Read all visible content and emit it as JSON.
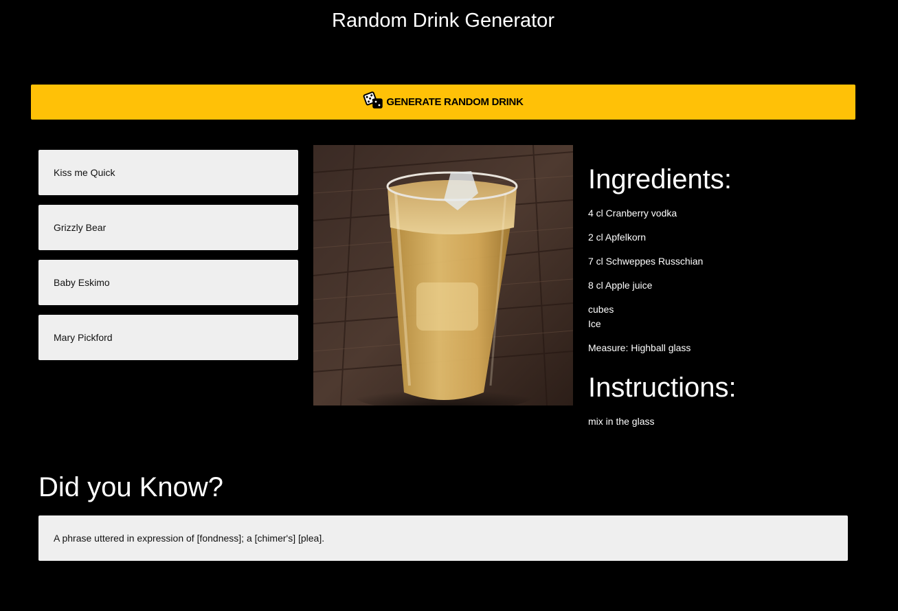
{
  "header": {
    "title": "Random Drink Generator"
  },
  "toolbar": {
    "generate_label": "GENERATE RANDOM DRINK",
    "generate_icon": "dice-icon"
  },
  "drinks": {
    "items": [
      {
        "label": "Kiss me Quick"
      },
      {
        "label": "Grizzly Bear"
      },
      {
        "label": "Baby Eskimo"
      },
      {
        "label": "Mary Pickford"
      }
    ]
  },
  "details": {
    "ingredients_heading": "Ingredients:",
    "ingredients": [
      "4 cl Cranberry vodka",
      "2 cl Apfelkorn",
      "7 cl Schweppes Russchian",
      "8 cl Apple juice"
    ],
    "ice_line_1": "cubes",
    "ice_line_2": "Ice",
    "measure": "Measure: Highball glass",
    "instructions_heading": "Instructions:",
    "instructions": "mix in the glass"
  },
  "fact": {
    "heading": "Did you Know?",
    "text": "A phrase uttered in expression of [fondness]; a [chimer's] [plea]."
  },
  "colors": {
    "background": "#000000",
    "accent": "#ffc107",
    "card": "#efefef"
  }
}
